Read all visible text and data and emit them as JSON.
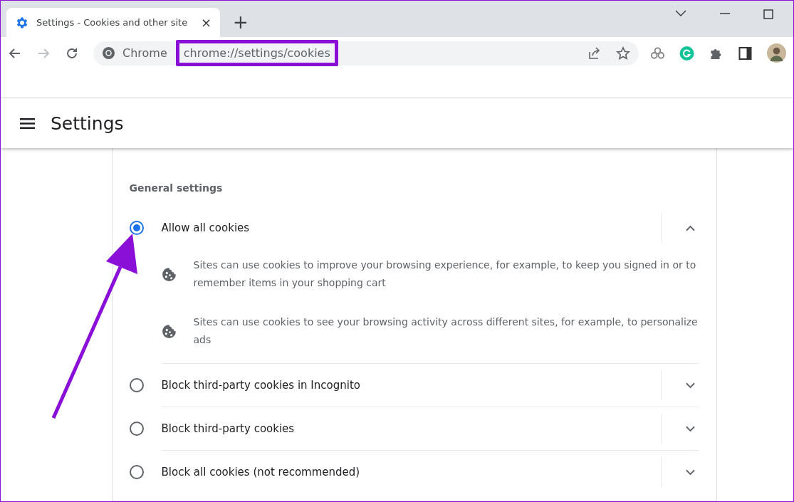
{
  "tab": {
    "title": "Settings - Cookies and other site",
    "close": "×",
    "new_tab": "+"
  },
  "toolbar": {
    "chip": "Chrome",
    "url": "chrome://settings/cookies"
  },
  "header": {
    "title": "Settings"
  },
  "section": {
    "title": "General settings"
  },
  "options": [
    {
      "label": "Allow all cookies",
      "selected": true,
      "expanded": true,
      "descriptions": [
        "Sites can use cookies to improve your browsing experience, for example, to keep you signed in or to remember items in your shopping cart",
        "Sites can use cookies to see your browsing activity across different sites, for example, to personalize ads"
      ]
    },
    {
      "label": "Block third-party cookies in Incognito",
      "selected": false,
      "expanded": false
    },
    {
      "label": "Block third-party cookies",
      "selected": false,
      "expanded": false
    },
    {
      "label": "Block all cookies (not recommended)",
      "selected": false,
      "expanded": false
    }
  ]
}
